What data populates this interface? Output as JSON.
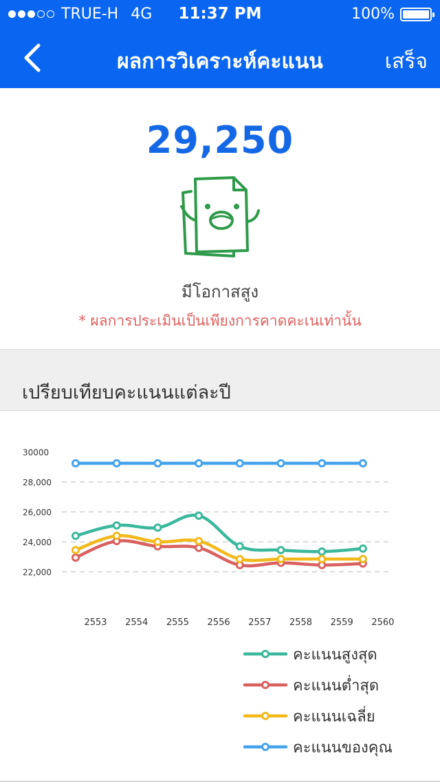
{
  "status_bar": {
    "signal_dots_filled": 3,
    "signal_dots_total": 5,
    "carrier": "TRUE-H",
    "network": "4G",
    "time": "11:37 PM",
    "battery": "100%"
  },
  "nav": {
    "back_icon": "chevron-left-icon",
    "title": "ผลการวิเคราะห์คะแนน",
    "done_label": "เสร็จ"
  },
  "result": {
    "score": "29,250",
    "mascot_icon": "happy-document-icon",
    "chance_label": "มีโอกาสสูง",
    "disclaimer": "* ผลการประเมินเป็นเพียงการคาดคะเนเท่านั้น"
  },
  "compare_section": {
    "title": "เปรียบเทียบคะแนนแต่ละปี"
  },
  "colors": {
    "primary": "#0a66f0",
    "score_text": "#1468e6",
    "disclaimer": "#e0605f"
  },
  "chart_data": {
    "type": "line",
    "title": "",
    "xlabel": "",
    "ylabel": "",
    "y_tick_labels": [
      "30000",
      "28,000",
      "26,000",
      "24,000",
      "22,000"
    ],
    "y_ticks": [
      30000,
      28000,
      26000,
      24000,
      22000
    ],
    "ylim": [
      21200,
      30400
    ],
    "x_tick_labels": [
      "2553",
      "2554",
      "2555",
      "2556",
      "2557",
      "2558",
      "2559",
      "2560"
    ],
    "grid": "horizontal dashed",
    "legend_position": "bottom-right",
    "series": [
      {
        "name": "คะแนนสูงสุด",
        "color": "#3bb89c",
        "values": [
          24400,
          25100,
          24950,
          25750,
          23700,
          23450,
          23350,
          23550
        ]
      },
      {
        "name": "คะแนนต่ำสุด",
        "color": "#d9615f",
        "values": [
          22950,
          24050,
          23700,
          23600,
          22450,
          22600,
          22450,
          22550
        ]
      },
      {
        "name": "คะแนนเฉลี่ย",
        "color": "#f2b91b",
        "values": [
          23450,
          24400,
          24000,
          24050,
          22850,
          22850,
          22850,
          22850
        ]
      },
      {
        "name": "คะแนนของคุณ",
        "color": "#45a3ec",
        "values": [
          29250,
          29250,
          29250,
          29250,
          29250,
          29250,
          29250,
          29250
        ]
      }
    ]
  }
}
